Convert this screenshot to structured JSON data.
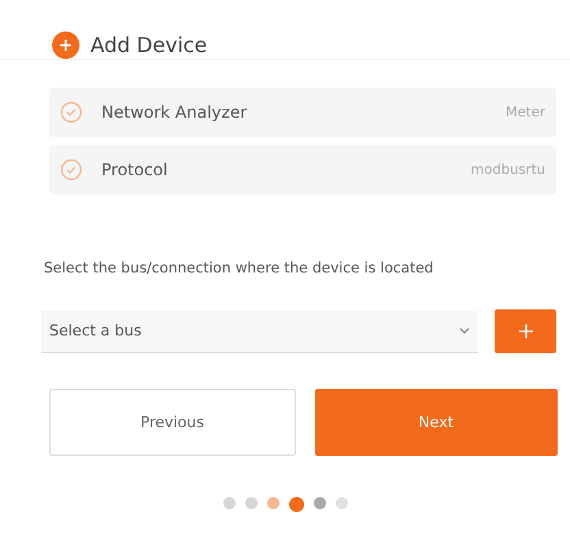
{
  "header": {
    "title": "Add Device"
  },
  "summary": [
    {
      "label": "Network Analyzer",
      "value": "Meter",
      "checked": true
    },
    {
      "label": "Protocol",
      "value": "modbusrtu",
      "checked": true
    }
  ],
  "instruction": "Select the bus/connection where the device is located",
  "bus_select": {
    "placeholder": "Select a bus"
  },
  "buttons": [
    {
      "label": "Previous",
      "kind": "secondary"
    },
    {
      "label": "Next",
      "kind": "primary"
    }
  ],
  "steps": [
    {
      "selected": false,
      "color": "#d6d6d6"
    },
    {
      "selected": false,
      "color": "#d6d6d6"
    },
    {
      "selected": false,
      "color": "#f7b78f"
    },
    {
      "selected": true,
      "color": "#f26a1b"
    },
    {
      "selected": false,
      "color": "#a9a9a9"
    },
    {
      "selected": false,
      "color": "#e0e0e0"
    }
  ]
}
